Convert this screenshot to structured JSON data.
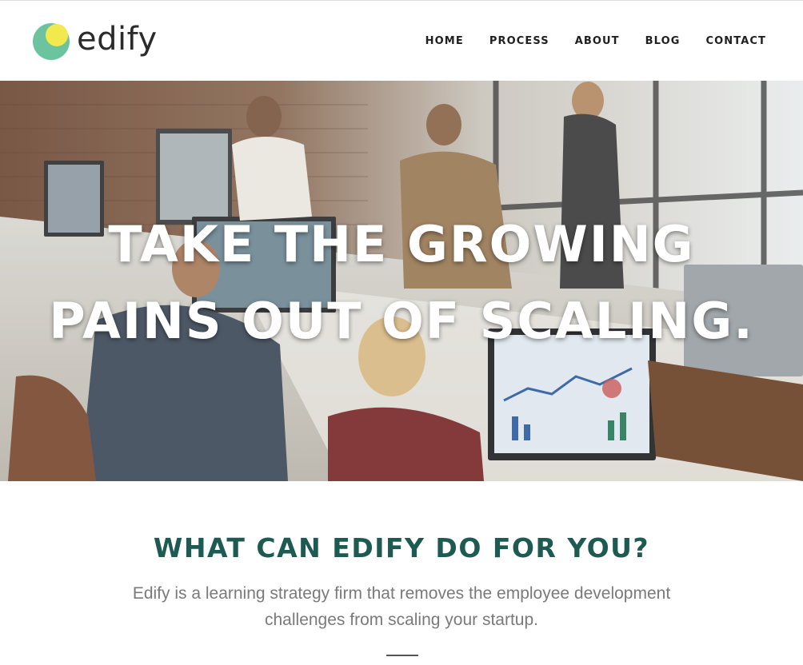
{
  "brand": {
    "name": "edify",
    "colors": {
      "mark_green": "#6cc3a0",
      "mark_yellow": "#f2e94e",
      "heading": "#1d5a52"
    }
  },
  "nav": {
    "items": [
      "HOME",
      "PROCESS",
      "ABOUT",
      "BLOG",
      "CONTACT"
    ]
  },
  "hero": {
    "line1": "TAKE THE GROWING",
    "line2": "PAINS OUT OF SCALING."
  },
  "section": {
    "heading": "WHAT CAN EDIFY DO FOR YOU?",
    "text": "Edify is a learning strategy firm that removes the employee development challenges from scaling your startup."
  }
}
